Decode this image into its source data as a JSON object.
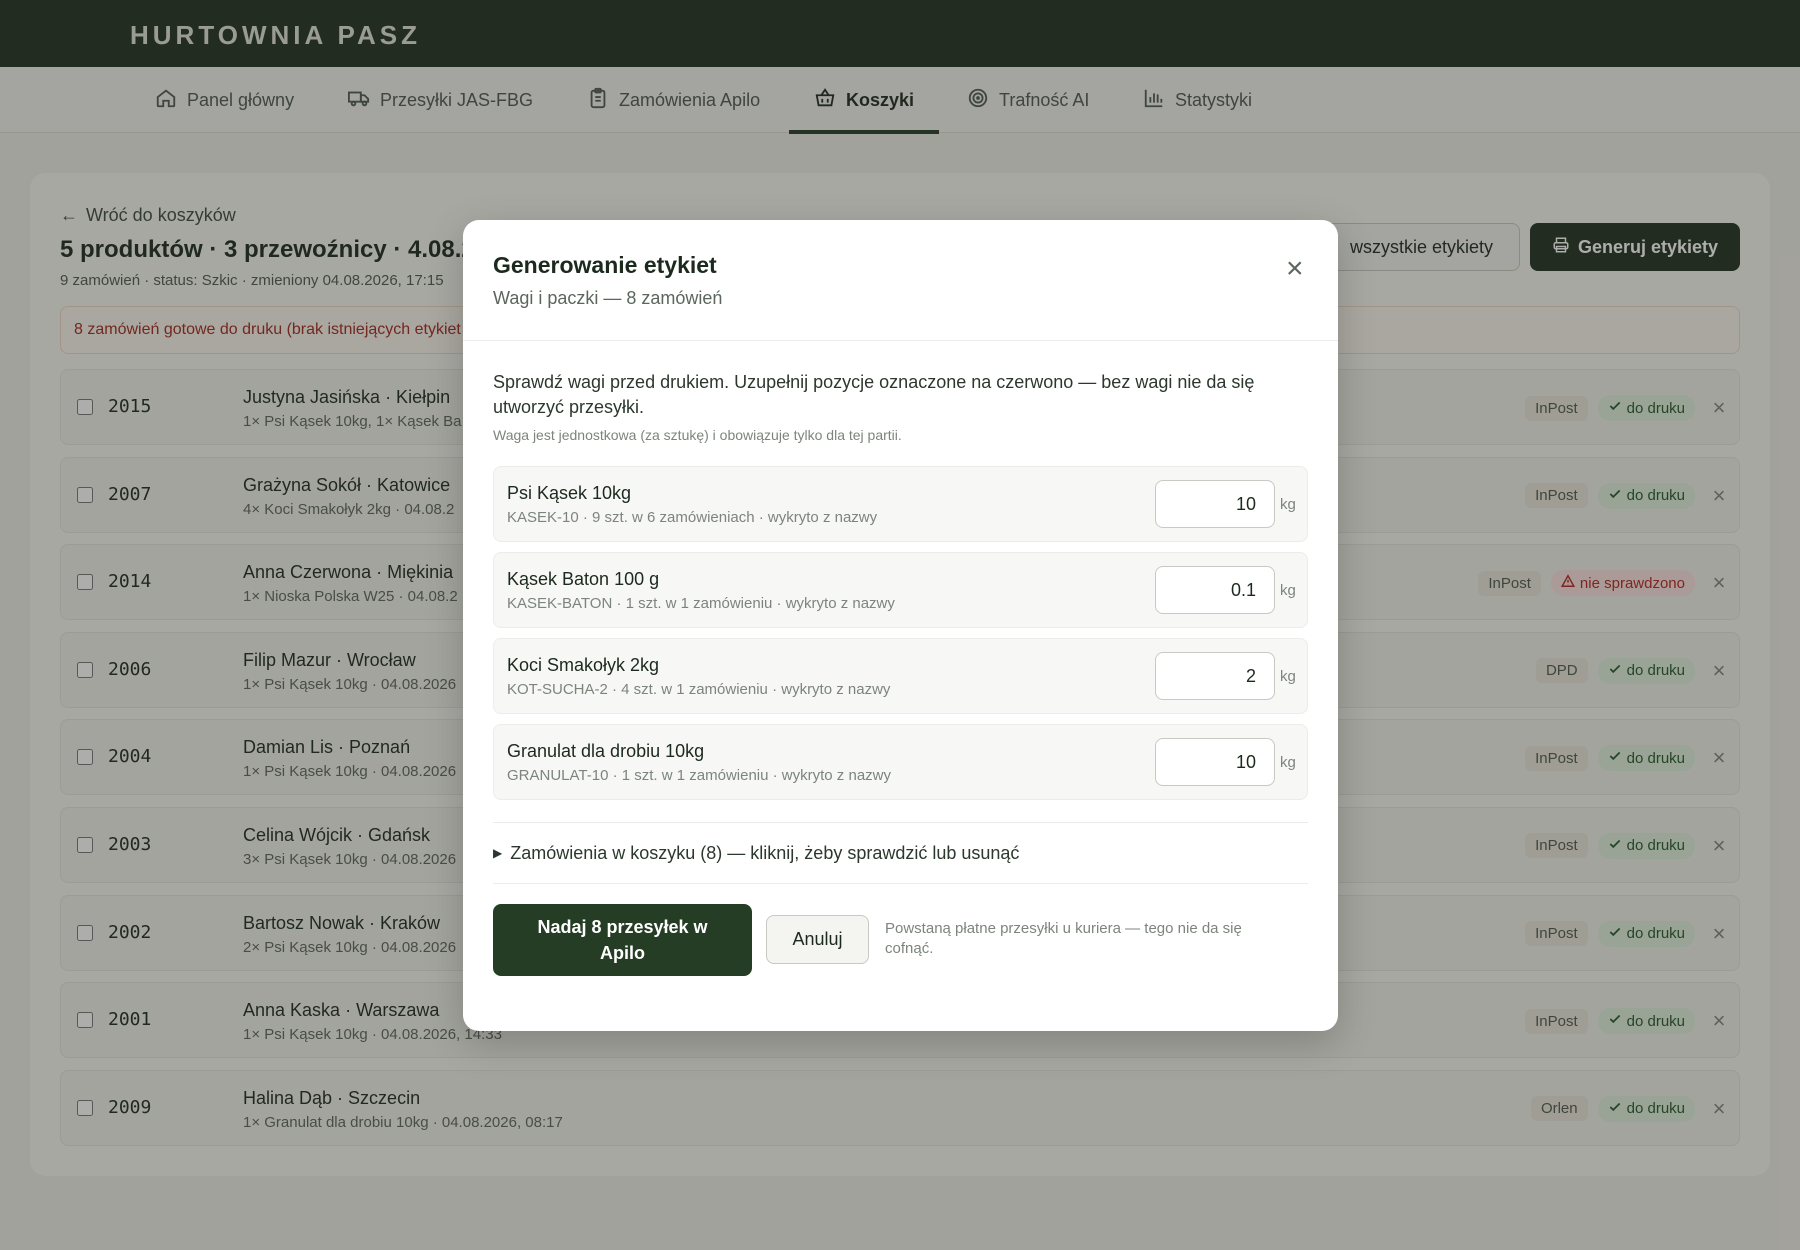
{
  "app": {
    "brand": "HURTOWNIA PASZ"
  },
  "nav": [
    {
      "label": "Panel główny",
      "icon": "home-icon"
    },
    {
      "label": "Przesyłki JAS-FBG",
      "icon": "truck-icon"
    },
    {
      "label": "Zamówienia Apilo",
      "icon": "clipboard-icon"
    },
    {
      "label": "Koszyki",
      "icon": "basket-icon",
      "active": true
    },
    {
      "label": "Trafność AI",
      "icon": "target-icon"
    },
    {
      "label": "Statystyki",
      "icon": "bar-chart-icon"
    }
  ],
  "page": {
    "back_label": "Wróć do koszyków",
    "title": "5 produktów · 3 przewoźnicy · 4.08.20",
    "subtitle": "9 zamówień · status: Szkic · zmieniony 04.08.2026, 17:15",
    "btn_all_labels": "wszystkie etykiety",
    "btn_generate": "Generuj etykiety",
    "alert": "8 zamówień gotowe do druku (brak istniejących etykiet"
  },
  "orders": [
    {
      "id": "2015",
      "name": "Justyna Jasińska · Kiełpin",
      "detail": "1× Psi Kąsek 10kg, 1× Kąsek Ba",
      "carrier": "InPost",
      "status": "do druku",
      "status_type": "ok"
    },
    {
      "id": "2007",
      "name": "Grażyna Sokół · Katowice",
      "detail": "4× Koci Smakołyk 2kg · 04.08.2",
      "carrier": "InPost",
      "status": "do druku",
      "status_type": "ok"
    },
    {
      "id": "2014",
      "name": "Anna Czerwona · Miękinia",
      "detail": "1× Nioska Polska W25 · 04.08.2",
      "carrier": "InPost",
      "status": "nie sprawdzono",
      "status_type": "warn"
    },
    {
      "id": "2006",
      "name": "Filip Mazur · Wrocław",
      "detail": "1× Psi Kąsek 10kg · 04.08.2026",
      "carrier": "DPD",
      "status": "do druku",
      "status_type": "ok"
    },
    {
      "id": "2004",
      "name": "Damian Lis · Poznań",
      "detail": "1× Psi Kąsek 10kg · 04.08.2026",
      "carrier": "InPost",
      "status": "do druku",
      "status_type": "ok"
    },
    {
      "id": "2003",
      "name": "Celina Wójcik · Gdańsk",
      "detail": "3× Psi Kąsek 10kg · 04.08.2026",
      "carrier": "InPost",
      "status": "do druku",
      "status_type": "ok"
    },
    {
      "id": "2002",
      "name": "Bartosz Nowak · Kraków",
      "detail": "2× Psi Kąsek 10kg · 04.08.2026",
      "carrier": "InPost",
      "status": "do druku",
      "status_type": "ok"
    },
    {
      "id": "2001",
      "name": "Anna Kaska · Warszawa",
      "detail": "1× Psi Kąsek 10kg · 04.08.2026, 14:33",
      "carrier": "InPost",
      "status": "do druku",
      "status_type": "ok"
    },
    {
      "id": "2009",
      "name": "Halina Dąb · Szczecin",
      "detail": "1× Granulat dla drobiu 10kg · 04.08.2026, 08:17",
      "carrier": "Orlen",
      "status": "do druku",
      "status_type": "ok"
    }
  ],
  "modal": {
    "title": "Generowanie etykiet",
    "subtitle": "Wagi i paczki — 8 zamówień",
    "intro": "Sprawdź wagi przed drukiem. Uzupełnij pozycje oznaczone na czerwono — bez wagi nie da się utworzyć przesyłki.",
    "note": "Waga jest jednostkowa (za sztukę) i obowiązuje tylko dla tej partii.",
    "items": [
      {
        "name": "Psi Kąsek 10kg",
        "meta": "KASEK-10 · 9 szt. w 6 zamówieniach · wykryto z nazwy",
        "weight": "10",
        "unit": "kg"
      },
      {
        "name": "Kąsek Baton 100 g",
        "meta": "KASEK-BATON · 1 szt. w 1 zamówieniu · wykryto z nazwy",
        "weight": "0.1",
        "unit": "kg"
      },
      {
        "name": "Koci Smakołyk 2kg",
        "meta": "KOT-SUCHA-2 · 4 szt. w 1 zamówieniu · wykryto z nazwy",
        "weight": "2",
        "unit": "kg"
      },
      {
        "name": "Granulat dla drobiu 10kg",
        "meta": "GRANULAT-10 · 1 szt. w 1 zamówieniu · wykryto z nazwy",
        "weight": "10",
        "unit": "kg"
      }
    ],
    "details_label": "Zamówienia w koszyku (8) — kliknij, żeby sprawdzić lub usunąć",
    "submit_label": "Nadaj 8 przesyłek w Apilo",
    "cancel_label": "Anuluj",
    "warning": "Powstaną płatne przesyłki u kuriera — tego nie da się cofnąć."
  }
}
